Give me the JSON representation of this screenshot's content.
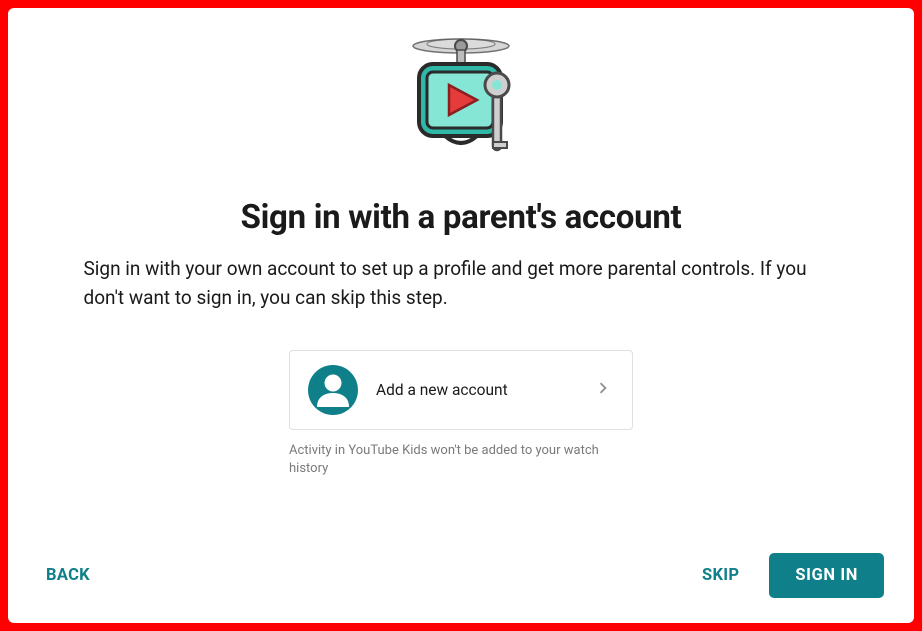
{
  "heading": "Sign in with a parent's account",
  "subtitle": "Sign in with your own account to set up a profile and get more parental controls. If you don't want to sign in, you can skip this step.",
  "account_card": {
    "label": "Add a new account"
  },
  "disclaimer": "Activity in YouTube Kids won't be added to your watch history",
  "footer": {
    "back": "BACK",
    "skip": "SKIP",
    "sign_in": "SIGN IN"
  },
  "colors": {
    "accent": "#0f7f8a",
    "brand_red": "#ff0000"
  }
}
